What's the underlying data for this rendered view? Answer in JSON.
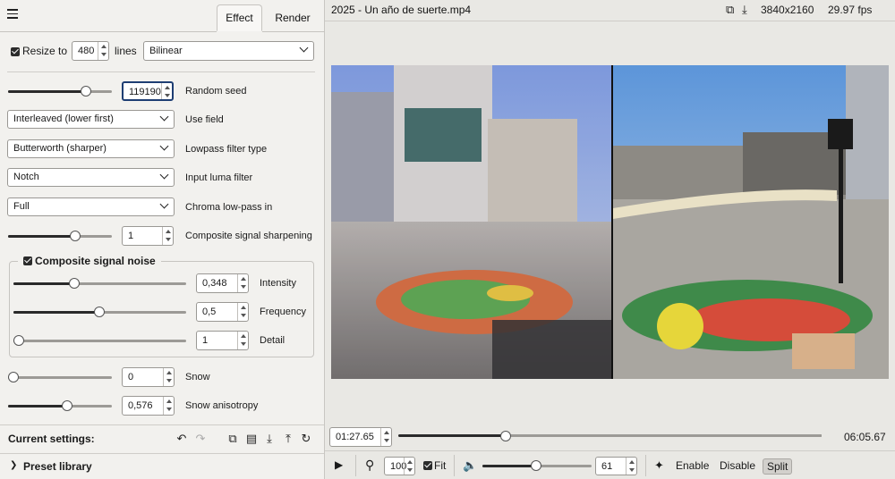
{
  "tabs": [
    {
      "label": "Effect"
    },
    {
      "label": "Render"
    }
  ],
  "resize": {
    "checkbox_label": "Resize to",
    "value": "480",
    "unit": "lines",
    "filter": "Bilinear",
    "checked": true
  },
  "random_seed": {
    "value": "119190",
    "label": "Random seed"
  },
  "use_field": {
    "value": "Interleaved (lower first)",
    "label": "Use field"
  },
  "lowpass": {
    "value": "Butterworth (sharper)",
    "label": "Lowpass filter type"
  },
  "input_luma": {
    "value": "Notch",
    "label": "Input luma filter"
  },
  "chroma_lowpass": {
    "value": "Full",
    "label": "Chroma low-pass in"
  },
  "sharpening": {
    "value": "1",
    "label": "Composite signal sharpening"
  },
  "noise_group": {
    "title": "Composite signal noise",
    "checked": true,
    "intensity": {
      "value": "0,348",
      "label": "Intensity"
    },
    "frequency": {
      "value": "0,5",
      "label": "Frequency"
    },
    "detail": {
      "value": "1",
      "label": "Detail"
    }
  },
  "snow": {
    "value": "0",
    "label": "Snow"
  },
  "snow_aniso": {
    "value": "0,576",
    "label": "Snow anisotropy"
  },
  "current_settings": {
    "label": "Current settings:"
  },
  "preset_library": {
    "label": "Preset library"
  },
  "video": {
    "filename": "2025 - Un año de suerte.mp4",
    "resolution": "3840x2160",
    "fps": "29.97 fps"
  },
  "playback": {
    "current_time": "01:27.65",
    "total_time": "06:05.67",
    "zoom": "100",
    "fit_label": "Fit",
    "volume": "61",
    "enable_label": "Enable",
    "disable_label": "Disable",
    "split_label": "Split"
  },
  "progress": {
    "position_fraction": 0.24,
    "volume_fraction": 0.61
  }
}
